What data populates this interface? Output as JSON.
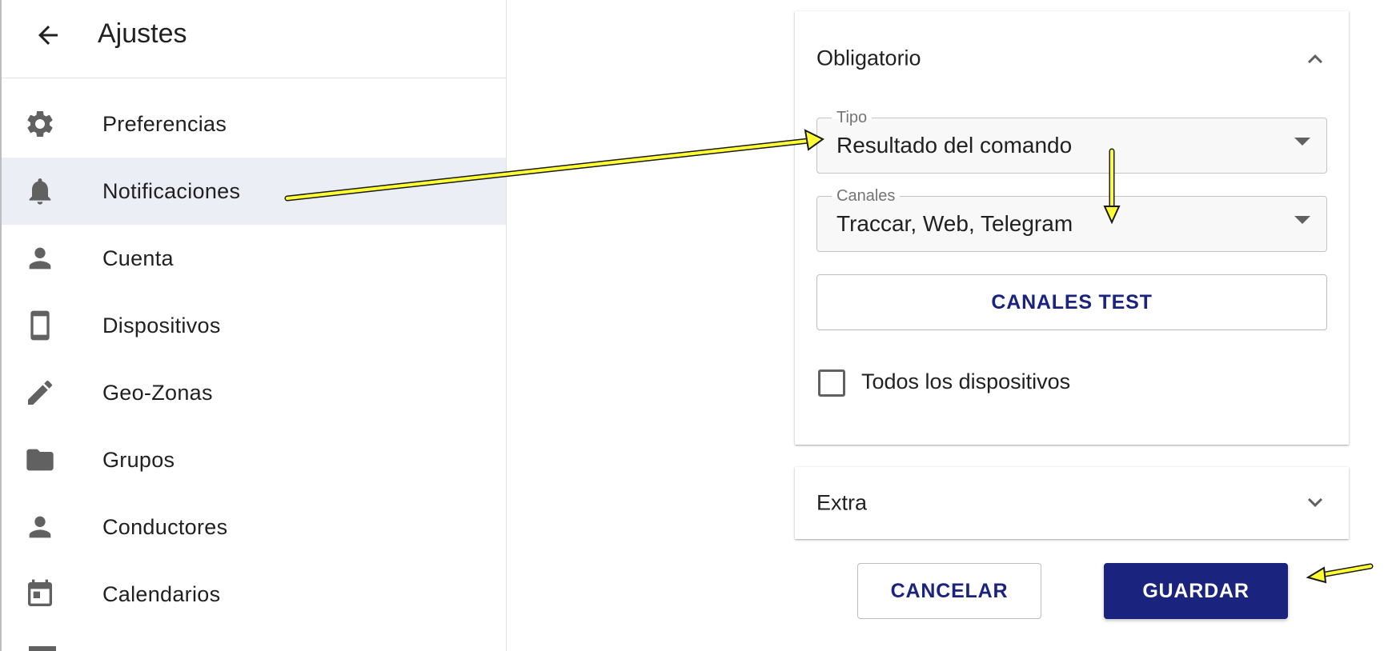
{
  "header": {
    "title": "Ajustes",
    "back_icon": "arrow-back-icon"
  },
  "sidebar": {
    "items": [
      {
        "label": "Preferencias",
        "icon": "gear-icon",
        "active": false
      },
      {
        "label": "Notificaciones",
        "icon": "bell-icon",
        "active": true
      },
      {
        "label": "Cuenta",
        "icon": "person-icon",
        "active": false
      },
      {
        "label": "Dispositivos",
        "icon": "smartphone-icon",
        "active": false
      },
      {
        "label": "Geo-Zonas",
        "icon": "pencil-icon",
        "active": false
      },
      {
        "label": "Grupos",
        "icon": "folder-icon",
        "active": false
      },
      {
        "label": "Conductores",
        "icon": "person-icon",
        "active": false
      },
      {
        "label": "Calendarios",
        "icon": "calendar-icon",
        "active": false
      }
    ]
  },
  "required_section": {
    "title": "Obligatorio",
    "expanded": true,
    "type_field": {
      "label": "Tipo",
      "value": "Resultado del comando"
    },
    "channels_field": {
      "label": "Canales",
      "value": "Traccar, Web, Telegram"
    },
    "test_button": "CANALES TEST",
    "all_devices": {
      "label": "Todos los dispositivos",
      "checked": false
    }
  },
  "extra_section": {
    "title": "Extra",
    "expanded": false
  },
  "actions": {
    "cancel": "CANCELAR",
    "save": "GUARDAR"
  },
  "colors": {
    "primary": "#1a237e",
    "active_bg": "#eceef5",
    "annotation_arrow": "#ffff33"
  }
}
